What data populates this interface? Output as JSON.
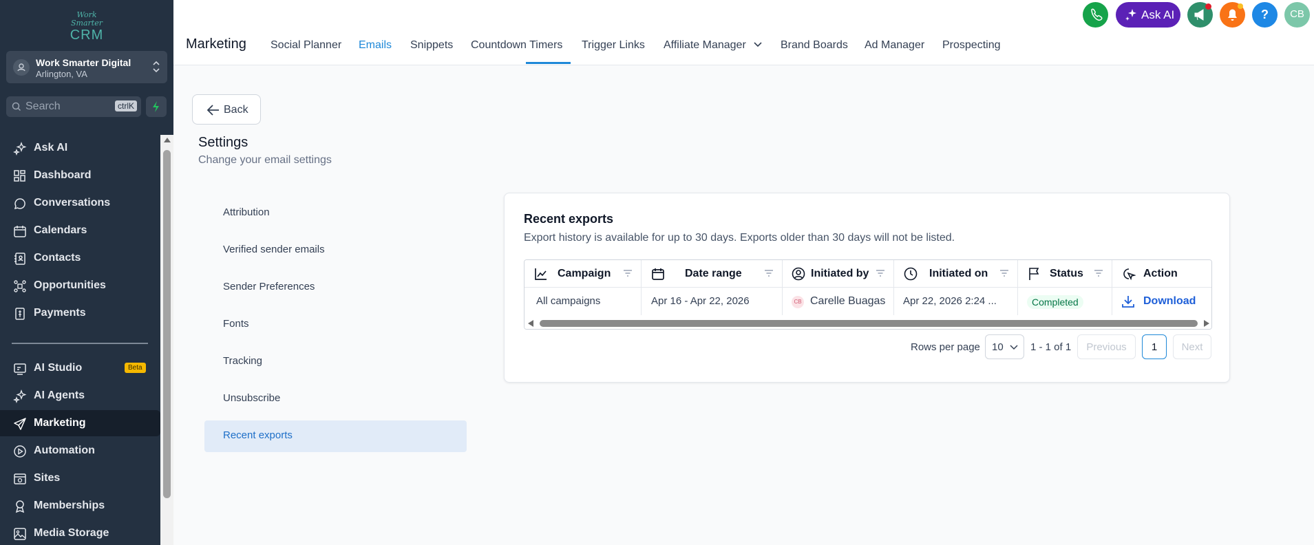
{
  "brand": {
    "logo_line1": "Work Smarter",
    "logo_line2": "CRM"
  },
  "location": {
    "name": "Work Smarter Digital",
    "city": "Arlington, VA"
  },
  "search": {
    "placeholder": "Search",
    "shortcut": "ctrlK"
  },
  "sidebar": {
    "items": [
      {
        "label": "Ask AI",
        "icon": "sparkle-icon"
      },
      {
        "label": "Dashboard",
        "icon": "grid-icon"
      },
      {
        "label": "Conversations",
        "icon": "chat-icon"
      },
      {
        "label": "Calendars",
        "icon": "calendar-icon"
      },
      {
        "label": "Contacts",
        "icon": "contacts-icon"
      },
      {
        "label": "Opportunities",
        "icon": "opportunities-icon"
      },
      {
        "label": "Payments",
        "icon": "payments-icon"
      },
      {
        "label": "AI Studio",
        "icon": "ai-studio-icon",
        "badge": "Beta"
      },
      {
        "label": "AI Agents",
        "icon": "sparkle-icon"
      },
      {
        "label": "Marketing",
        "icon": "send-icon",
        "active": true
      },
      {
        "label": "Automation",
        "icon": "automation-icon"
      },
      {
        "label": "Sites",
        "icon": "sites-icon"
      },
      {
        "label": "Memberships",
        "icon": "memberships-icon"
      },
      {
        "label": "Media Storage",
        "icon": "image-icon"
      }
    ]
  },
  "header": {
    "section": "Marketing",
    "tabs": [
      {
        "label": "Social Planner"
      },
      {
        "label": "Emails",
        "active": true
      },
      {
        "label": "Snippets"
      },
      {
        "label": "Countdown Timers"
      },
      {
        "label": "Trigger Links"
      },
      {
        "label": "Affiliate Manager"
      },
      {
        "label": "Brand Boards"
      },
      {
        "label": "Ad Manager"
      },
      {
        "label": "Prospecting"
      }
    ],
    "ask_ai": "Ask AI",
    "help": "?",
    "user_initials": "CB"
  },
  "page": {
    "back": "Back",
    "title": "Settings",
    "subtitle": "Change your email settings",
    "menu": [
      {
        "label": "Attribution"
      },
      {
        "label": "Verified sender emails"
      },
      {
        "label": "Sender Preferences"
      },
      {
        "label": "Fonts"
      },
      {
        "label": "Tracking"
      },
      {
        "label": "Unsubscribe"
      },
      {
        "label": "Recent exports",
        "active": true
      }
    ]
  },
  "exports": {
    "title": "Recent exports",
    "description": "Export history is available for up to 30 days. Exports older than 30 days will not be listed.",
    "columns": [
      "Campaign",
      "Date range",
      "Initiated by",
      "Initiated on",
      "Status",
      "Action"
    ],
    "rows": [
      {
        "campaign": "All campaigns",
        "date_range": "Apr 16 - Apr 22, 2026",
        "initiated_by_initials": "CB",
        "initiated_by": "Carelle Buagas",
        "initiated_on": "Apr 22, 2026 2:24 ...",
        "status": "Completed",
        "action": "Download"
      }
    ],
    "pagination": {
      "rows_per_page_label": "Rows per page",
      "rows_per_page": "10",
      "range": "1 - 1 of 1",
      "previous": "Previous",
      "page": "1",
      "next": "Next"
    }
  },
  "colors": {
    "sidebar_bg": "#243141",
    "accent": "#1e88d8",
    "ask_ai_bg": "#5b21b6",
    "phone_bg": "#16a34a"
  }
}
